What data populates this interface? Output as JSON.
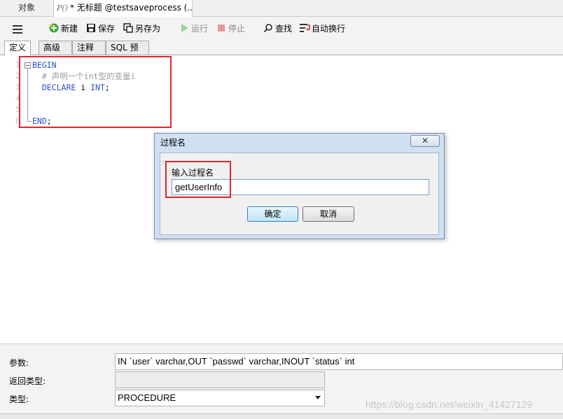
{
  "tabs": {
    "objects_label": "对象",
    "active_icon_text": "P()",
    "active_label": "* 无标题 @testsaveprocess (..."
  },
  "toolbar": {
    "new_label": "新建",
    "save_label": "保存",
    "save_as_label": "另存为",
    "run_label": "运行",
    "stop_label": "停止",
    "find_label": "查找",
    "wrap_label": "自动换行"
  },
  "subtabs": [
    "定义",
    "高级",
    "注释",
    "SQL 预览"
  ],
  "editor": {
    "line_numbers": [
      "1",
      "2",
      "3",
      "4",
      "5",
      "6"
    ],
    "lines": {
      "l1": "BEGIN",
      "l2": "  # 声明一个int型的变量i",
      "l3_kw1": "DECLARE",
      "l3_mid": " i ",
      "l3_kw2": "INT",
      "l3_end": ";",
      "l6_kw": "END",
      "l6_end": ";"
    }
  },
  "dialog": {
    "title": "过程名",
    "close_glyph": "✕",
    "label": "输入过程名",
    "input_value": "getUserInfo",
    "ok_label": "确定",
    "cancel_label": "取消"
  },
  "properties": {
    "params_label": "参数:",
    "params_value": "IN `user` varchar,OUT `passwd` varchar,INOUT `status` int",
    "return_label": "返回类型:",
    "return_value": "",
    "type_label": "类型:",
    "type_value": "PROCEDURE"
  },
  "watermark": "https://blog.csdn.net/weixin_41427129",
  "colors": {
    "keyword": "#2a4fd0",
    "comment": "#9a9a9a",
    "highlight_box": "#e0262b",
    "dialog_frame": "#cfe0f1"
  },
  "icons": {
    "menu": "hamburger-icon",
    "new": "plus-circle-icon",
    "save": "floppy-icon",
    "save_as": "save-as-icon",
    "run": "play-icon",
    "stop": "stop-icon",
    "find": "magnifier-icon",
    "wrap": "word-wrap-icon"
  }
}
